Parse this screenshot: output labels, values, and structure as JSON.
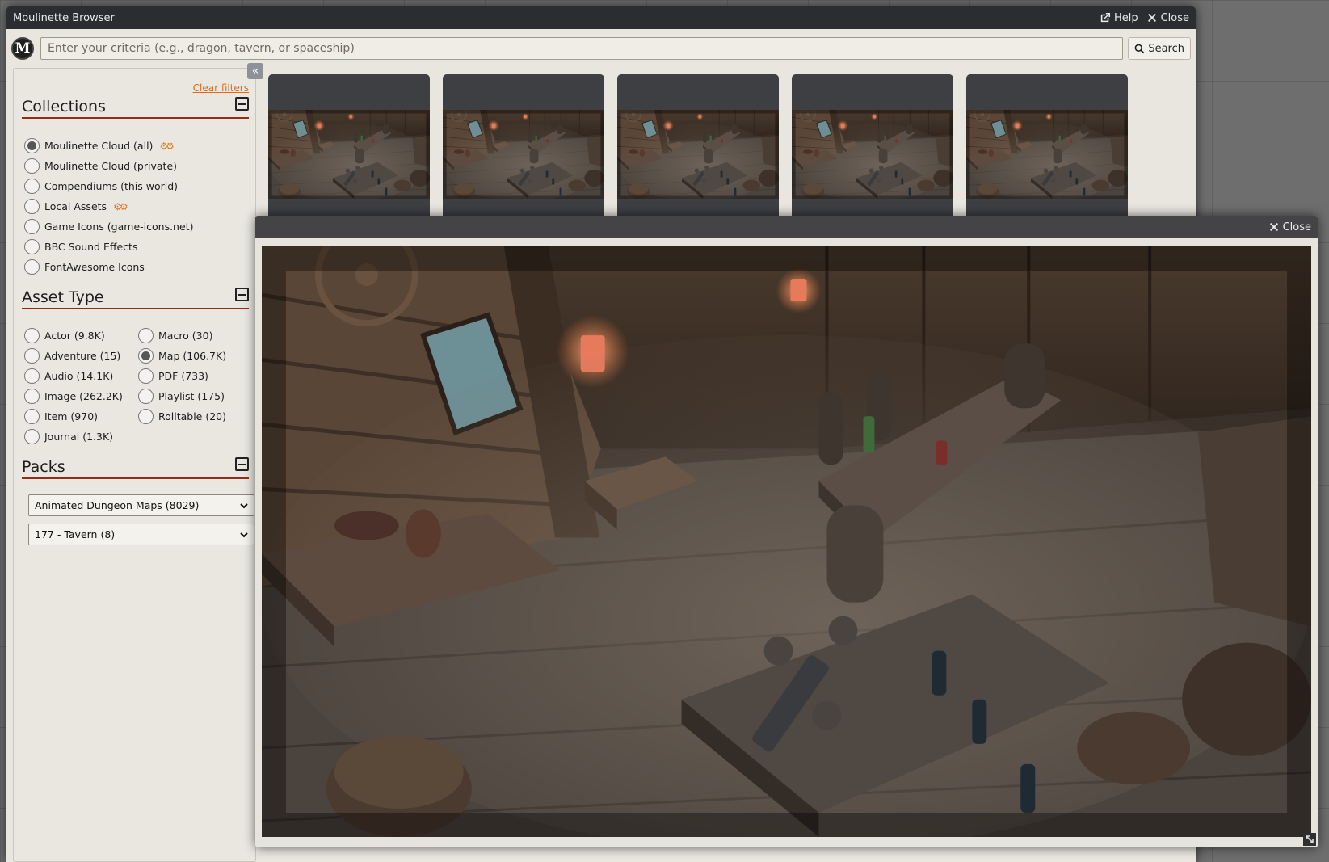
{
  "window": {
    "title": "Moulinette Browser",
    "help_label": "Help",
    "close_label": "Close"
  },
  "search": {
    "logo_letter": "M",
    "placeholder": "Enter your criteria (e.g., dragon, tavern, or spaceship)",
    "button_label": "Search"
  },
  "sidebar": {
    "collapse_glyph": "«",
    "clear_filters": "Clear filters",
    "collections": {
      "title": "Collections",
      "items": [
        {
          "label": "Moulinette Cloud (all)",
          "checked": true,
          "gear": true
        },
        {
          "label": "Moulinette Cloud (private)",
          "checked": false,
          "gear": false
        },
        {
          "label": "Compendiums (this world)",
          "checked": false,
          "gear": false
        },
        {
          "label": "Local Assets",
          "checked": false,
          "gear": true
        },
        {
          "label": "Game Icons (game-icons.net)",
          "checked": false,
          "gear": false
        },
        {
          "label": "BBC Sound Effects",
          "checked": false,
          "gear": false
        },
        {
          "label": "FontAwesome Icons",
          "checked": false,
          "gear": false
        }
      ]
    },
    "asset_type": {
      "title": "Asset Type",
      "left": [
        {
          "label": "Actor (9.8K)",
          "checked": false
        },
        {
          "label": "Adventure (15)",
          "checked": false
        },
        {
          "label": "Audio (14.1K)",
          "checked": false
        },
        {
          "label": "Image (262.2K)",
          "checked": false
        },
        {
          "label": "Item (970)",
          "checked": false
        },
        {
          "label": "Journal (1.3K)",
          "checked": false
        }
      ],
      "right": [
        {
          "label": "Macro (30)",
          "checked": false
        },
        {
          "label": "Map (106.7K)",
          "checked": true
        },
        {
          "label": "PDF (733)",
          "checked": false
        },
        {
          "label": "Playlist (175)",
          "checked": false
        },
        {
          "label": "Rolltable (20)",
          "checked": false
        }
      ]
    },
    "packs": {
      "title": "Packs",
      "creator_selected": "Animated Dungeon Maps (8029)",
      "pack_selected": "177 - Tavern (8)"
    }
  },
  "thumbnails": {
    "count": 5
  },
  "preview": {
    "close_label": "Close"
  },
  "icons": {
    "help": "external-link-icon",
    "close": "close-x-icon",
    "search": "magnifier-icon",
    "gear": "gears-icon",
    "collapse": "double-chevron-left-icon",
    "section_toggle": "minus-square-icon",
    "dropdown": "chevron-down-icon",
    "resize": "resize-corner-icon"
  },
  "colors": {
    "header_bg": "#2b2d30",
    "accent_link": "#e06a1b",
    "section_underline": "#9a2a18",
    "panel_bg": "#e8e6de"
  }
}
